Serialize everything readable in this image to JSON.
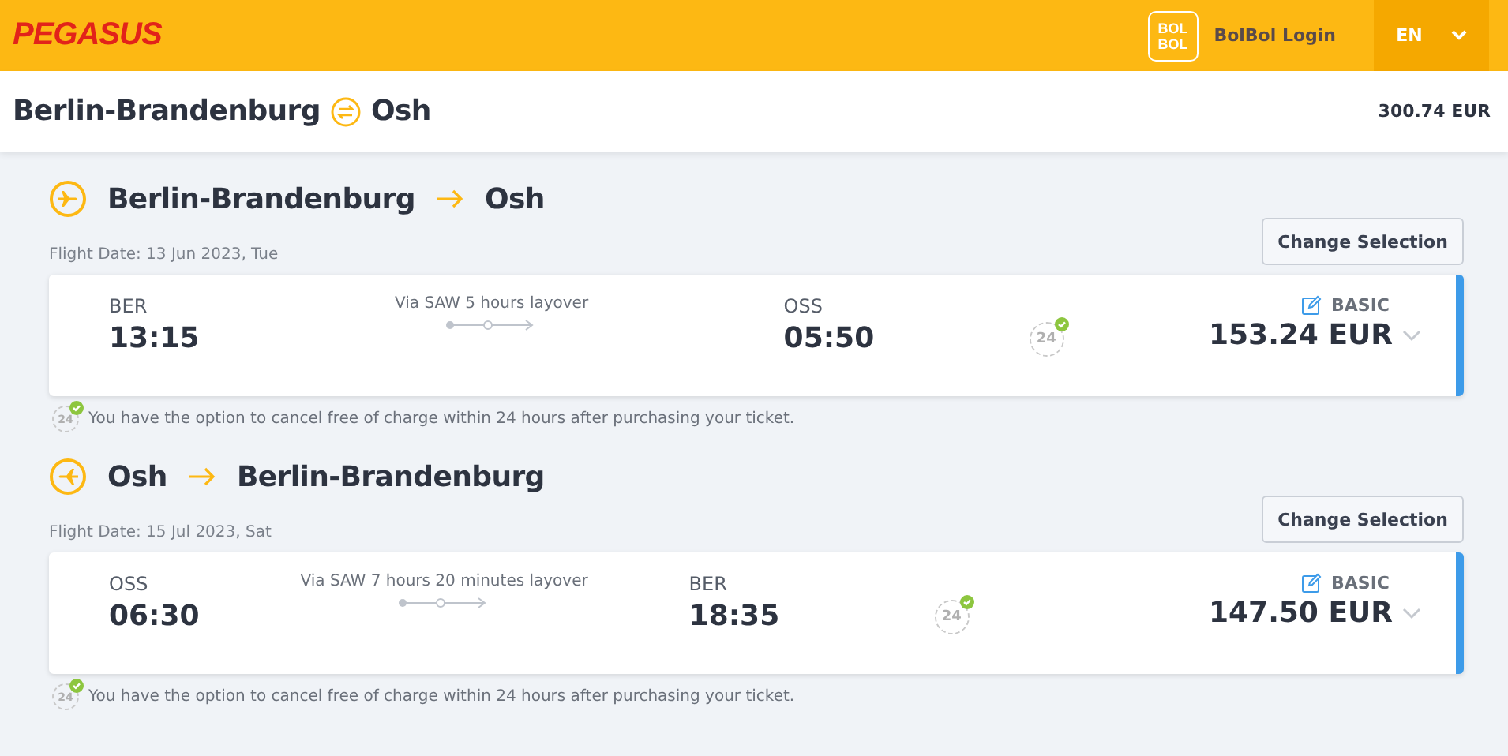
{
  "header": {
    "logo": "PEGASUS",
    "bolbol_logo": [
      "BOL",
      "BOL"
    ],
    "login": "BolBol Login",
    "language": "EN"
  },
  "summary": {
    "origin": "Berlin-Brandenburg",
    "destination": "Osh",
    "total": "300.74 EUR"
  },
  "flights": [
    {
      "kind": "outbound",
      "origin": "Berlin-Brandenburg",
      "destination": "Osh",
      "date": "Flight Date: 13 Jun 2023, Tue",
      "button": "Change Selection",
      "dep_code": "BER",
      "dep_time": "13:15",
      "via": "Via SAW 5 hours layover",
      "arr_code": "OSS",
      "arr_time": "05:50",
      "badge": "24",
      "fare": "BASIC",
      "price": "153.24 EUR",
      "note_badge": "24",
      "note": "You have the option to cancel free of charge within 24 hours after purchasing your ticket."
    },
    {
      "kind": "return",
      "origin": "Osh",
      "destination": "Berlin-Brandenburg",
      "date": "Flight Date: 15 Jul 2023, Sat",
      "button": "Change Selection",
      "dep_code": "OSS",
      "dep_time": "06:30",
      "via": "Via SAW 7 hours 20 minutes layover",
      "arr_code": "BER",
      "arr_time": "18:35",
      "badge": "24",
      "fare": "BASIC",
      "price": "147.50 EUR",
      "note_badge": "24",
      "note": "You have the option to cancel free of charge within 24 hours after purchasing your ticket."
    }
  ]
}
